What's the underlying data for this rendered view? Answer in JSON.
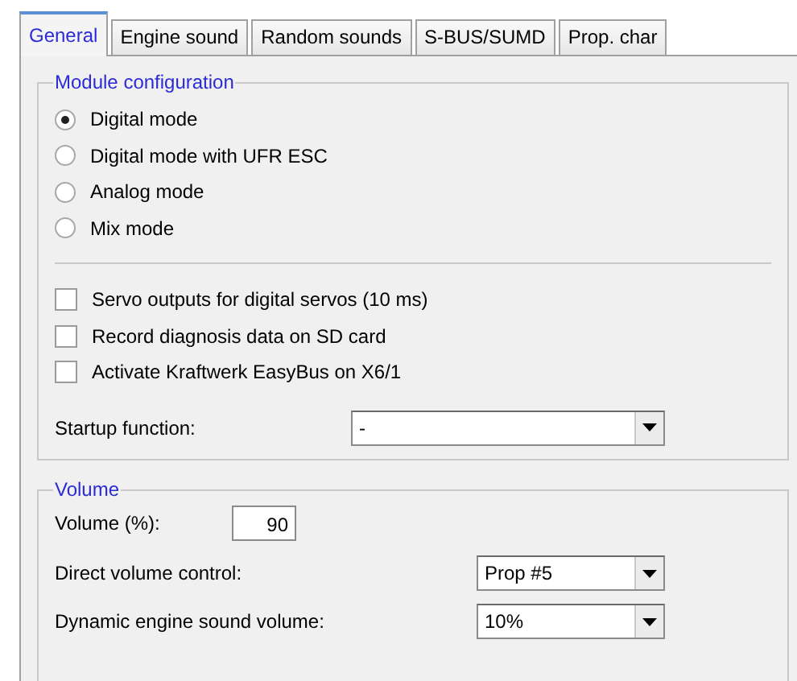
{
  "tabs": [
    {
      "label": "General",
      "selected": true
    },
    {
      "label": "Engine sound",
      "selected": false
    },
    {
      "label": "Random sounds",
      "selected": false
    },
    {
      "label": "S-BUS/SUMD",
      "selected": false
    },
    {
      "label": "Prop. char",
      "selected": false
    }
  ],
  "module_configuration": {
    "title": "Module configuration",
    "modes": [
      {
        "label": "Digital mode",
        "selected": true
      },
      {
        "label": "Digital mode with UFR ESC",
        "selected": false
      },
      {
        "label": "Analog mode",
        "selected": false
      },
      {
        "label": "Mix mode",
        "selected": false
      }
    ],
    "options": [
      {
        "label": "Servo outputs for digital servos (10 ms)",
        "checked": false
      },
      {
        "label": "Record diagnosis data on SD card",
        "checked": false
      },
      {
        "label": "Activate Kraftwerk EasyBus on X6/1",
        "checked": false
      }
    ],
    "startup_function": {
      "label": "Startup function:",
      "value": "-"
    }
  },
  "volume": {
    "title": "Volume",
    "volume_percent": {
      "label": "Volume (%):",
      "value": "90"
    },
    "direct_volume_control": {
      "label": "Direct volume control:",
      "value": "Prop #5"
    },
    "dynamic_engine_sound_volume": {
      "label": "Dynamic engine sound volume:",
      "value": "10%"
    }
  }
}
